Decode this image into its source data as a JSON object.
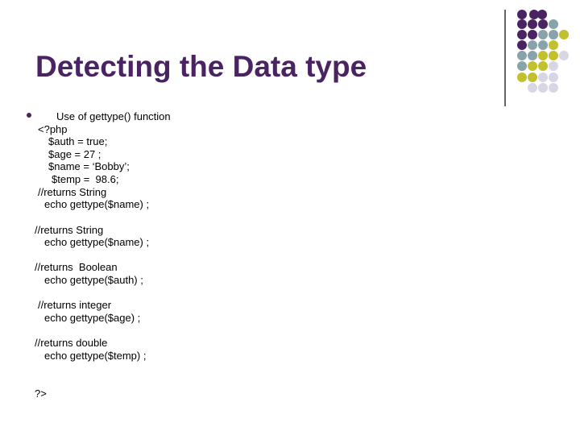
{
  "slide": {
    "title": "Detecting the Data type",
    "colors": {
      "title": "#4a2462",
      "dot_purple": "#4a2462",
      "dot_teal": "#88a3a9",
      "dot_olive": "#c2c02d",
      "dot_lavender": "#d8d6e4",
      "bullet": "#4a2462"
    },
    "bullet_text": "Use of gettype() function",
    "code_lines": [
      "<?php",
      "$auth = true;",
      "$age = 27 ;",
      "$name = ‘Bobby’;",
      "$temp =  98.6;",
      "//returns String",
      "echo gettype($name) ;",
      "//returns String",
      "echo gettype($name) ;",
      "//returns  Boolean",
      "echo gettype($auth) ;",
      "//returns integer",
      "echo gettype($age) ;",
      "//returns double",
      "echo gettype($temp) ;",
      "?>"
    ]
  }
}
